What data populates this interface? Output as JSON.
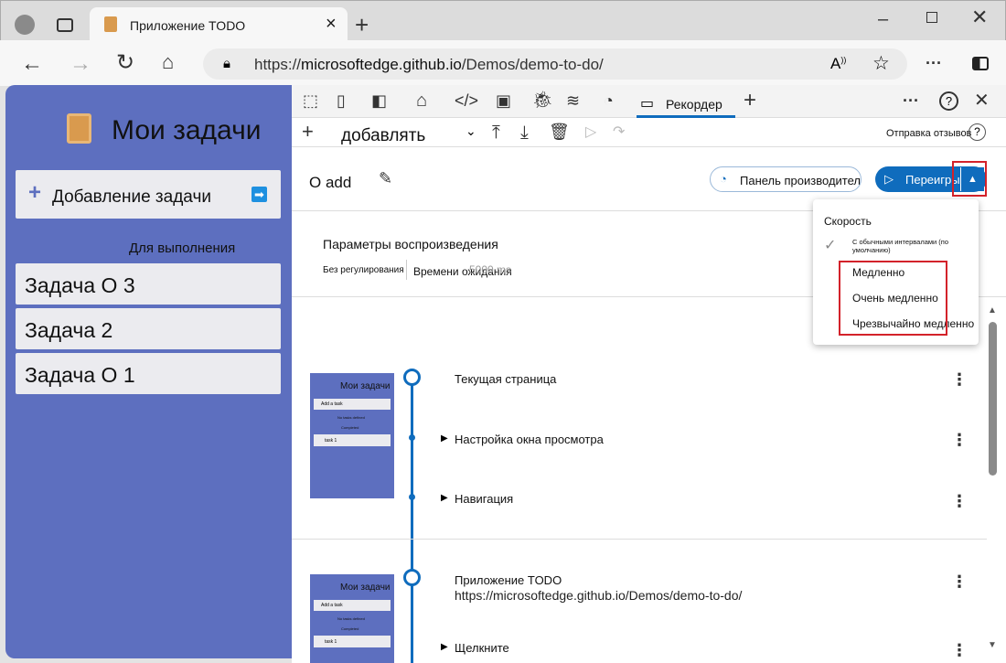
{
  "browser": {
    "tab_title": "Приложение TODO",
    "url_prefix": "https://",
    "url_host": "microsoftedge.github.io",
    "url_path": "/Demos/demo-to-do/"
  },
  "app": {
    "title": "Мои задачи",
    "add_task": "Добавление задачи",
    "section_label": "Для выполнения",
    "tasks": [
      "Задача О 3",
      "Задача 2",
      "Задача О 1"
    ]
  },
  "devtools": {
    "recorder_tab": "Рекордер",
    "recording_select": "добавлять",
    "feedback": "Отправка отзывов",
    "recording_name": "О add",
    "perf_panel_button": "Панель производительности",
    "replay_button": "Переигрывать",
    "replay_settings_title": "Параметры воспроизведения",
    "throttling": "Без регулирования",
    "timeout_label": "Времени ожидания",
    "timeout_value": "5000 ms"
  },
  "speed_menu": {
    "title": "Скорость",
    "items": [
      "С обычными интервалами (по умолчанию)",
      "Медленно",
      "Очень медленно",
      "Чрезвычайно медленно"
    ]
  },
  "steps": {
    "group1": [
      "Текущая страница",
      "Настройка окна просмотра",
      "Навигация"
    ],
    "group2_title": "Приложение TODO",
    "group2_url": "https://microsoftedge.github.io/Demos/demo-to-do/",
    "group2_step": "Щелкните"
  },
  "thumb": {
    "title": "Мои задачи",
    "add": "Add a task",
    "sub1": "No tasks defined",
    "sub2": "Completed",
    "item": "task 1"
  }
}
